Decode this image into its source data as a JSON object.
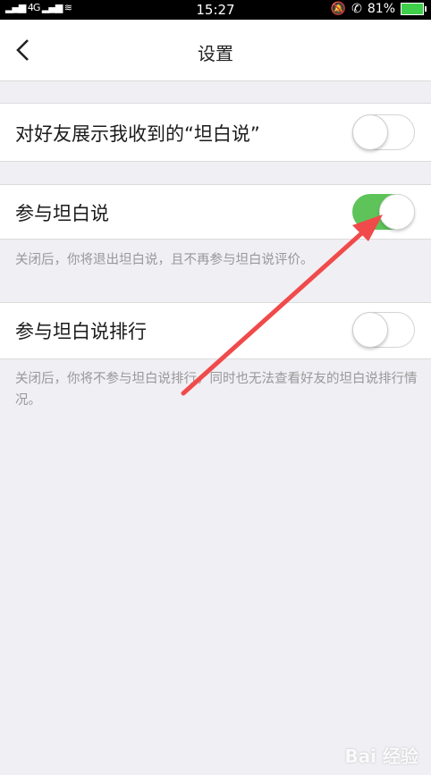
{
  "status_bar": {
    "signal": "4G",
    "time": "15:27",
    "battery": "81%"
  },
  "nav": {
    "title": "设置"
  },
  "settings": [
    {
      "label": "对好友展示我收到的“坦白说”",
      "enabled": false
    },
    {
      "label": "参与坦白说",
      "enabled": true,
      "hint": "关闭后，你将退出坦白说，且不再参与坦白说评价。"
    },
    {
      "label": "参与坦白说排行",
      "enabled": false,
      "hint": "关闭后，你将不参与坦白说排行，同时也无法查看好友的坦白说排行情况。"
    }
  ],
  "colors": {
    "toggle_on": "#5ec45a",
    "annotation_arrow": "#f04a4a"
  },
  "watermark": "Bai 经验"
}
